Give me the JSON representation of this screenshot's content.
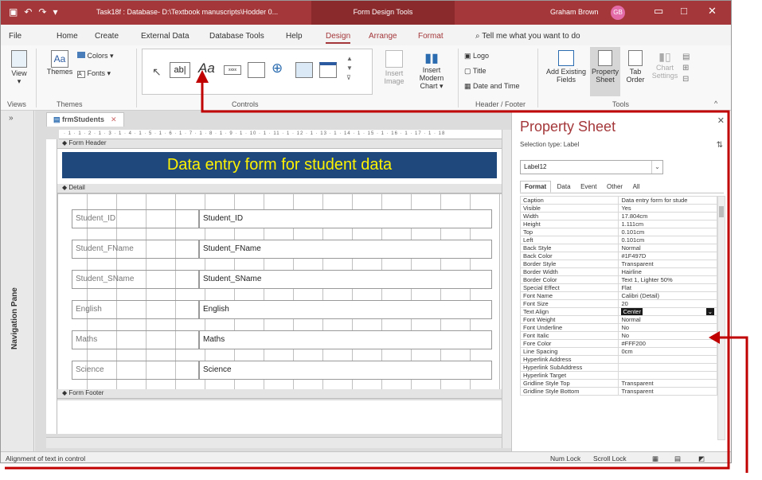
{
  "titlebar": {
    "document_title": "Task18f : Database- D:\\Textbook manuscripts\\Hodder 0...",
    "context_tools": "Form Design Tools",
    "user_name": "Graham Brown",
    "user_initials": "GB"
  },
  "ribbon_tabs": [
    "File",
    "Home",
    "Create",
    "External Data",
    "Database Tools",
    "Help",
    "Design",
    "Arrange",
    "Format"
  ],
  "active_tab": "Design",
  "tell_me": "Tell me what you want to do",
  "ribbon": {
    "view": "View",
    "themes": "Themes",
    "colors": "Colors",
    "fonts": "Fonts",
    "insert_image": "Insert Image",
    "insert_modern_chart": "Insert Modern Chart",
    "logo": "Logo",
    "title": "Title",
    "date_time": "Date and Time",
    "add_existing_fields": "Add Existing Fields",
    "property_sheet": "Property Sheet",
    "tab_order": "Tab Order",
    "chart_settings": "Chart Settings",
    "groups": {
      "views": "Views",
      "themes": "Themes",
      "controls": "Controls",
      "header_footer": "Header / Footer",
      "tools": "Tools"
    }
  },
  "nav_pane": {
    "label": "Navigation Pane"
  },
  "document": {
    "tab_label": "frmStudents",
    "ruler_text": "· 1 · 1 · 2 · 1 · 3 · 1 · 4 · 1 · 5 · 1 · 6 · 1 · 7 · 1 · 8 · 1 · 9 · 1 · 10 · 1 · 11 · 1 · 12 · 1 · 13 · 1 · 14 · 1 · 15 · 1 · 16 · 1 · 17 · 1 · 18",
    "form_header_label": "Form Header",
    "detail_label": "Detail",
    "form_footer_label": "Form Footer",
    "header_caption": "Data entry form for student data",
    "fields": [
      {
        "label": "Student_ID",
        "control": "Student_ID"
      },
      {
        "label": "Student_FName",
        "control": "Student_FName"
      },
      {
        "label": "Student_SName",
        "control": "Student_SName"
      },
      {
        "label": "English",
        "control": "English"
      },
      {
        "label": "Maths",
        "control": "Maths"
      },
      {
        "label": "Science",
        "control": "Science"
      }
    ]
  },
  "property_sheet": {
    "title": "Property Sheet",
    "selection_type": "Selection type:  Label",
    "selected_object": "Label12",
    "tabs": [
      "Format",
      "Data",
      "Event",
      "Other",
      "All"
    ],
    "active_tab": "Format",
    "rows": [
      {
        "name": "Caption",
        "value": "Data entry form for stude"
      },
      {
        "name": "Visible",
        "value": "Yes"
      },
      {
        "name": "Width",
        "value": "17.804cm"
      },
      {
        "name": "Height",
        "value": "1.111cm"
      },
      {
        "name": "Top",
        "value": "0.101cm"
      },
      {
        "name": "Left",
        "value": "0.101cm"
      },
      {
        "name": "Back Style",
        "value": "Normal"
      },
      {
        "name": "Back Color",
        "value": "#1F497D"
      },
      {
        "name": "Border Style",
        "value": "Transparent"
      },
      {
        "name": "Border Width",
        "value": "Hairline"
      },
      {
        "name": "Border Color",
        "value": "Text 1, Lighter 50%"
      },
      {
        "name": "Special Effect",
        "value": "Flat"
      },
      {
        "name": "Font Name",
        "value": "Calibri (Detail)"
      },
      {
        "name": "Font Size",
        "value": "20"
      },
      {
        "name": "Text Align",
        "value": "Center"
      },
      {
        "name": "Font Weight",
        "value": "Normal"
      },
      {
        "name": "Font Underline",
        "value": "No"
      },
      {
        "name": "Font Italic",
        "value": "No"
      },
      {
        "name": "Fore Color",
        "value": "#FFF200"
      },
      {
        "name": "Line Spacing",
        "value": "0cm"
      },
      {
        "name": "Hyperlink Address",
        "value": ""
      },
      {
        "name": "Hyperlink SubAddress",
        "value": ""
      },
      {
        "name": "Hyperlink Target",
        "value": ""
      },
      {
        "name": "Gridline Style Top",
        "value": "Transparent"
      },
      {
        "name": "Gridline Style Bottom",
        "value": "Transparent"
      }
    ],
    "selected_row": "Text Align"
  },
  "status_bar": {
    "message": "Alignment of text in control",
    "num_lock": "Num Lock",
    "scroll_lock": "Scroll Lock"
  },
  "colors": {
    "titlebar": "#a4373a",
    "header_back": "#1f497d",
    "header_fore": "#fff200",
    "annotation": "#c00000"
  }
}
